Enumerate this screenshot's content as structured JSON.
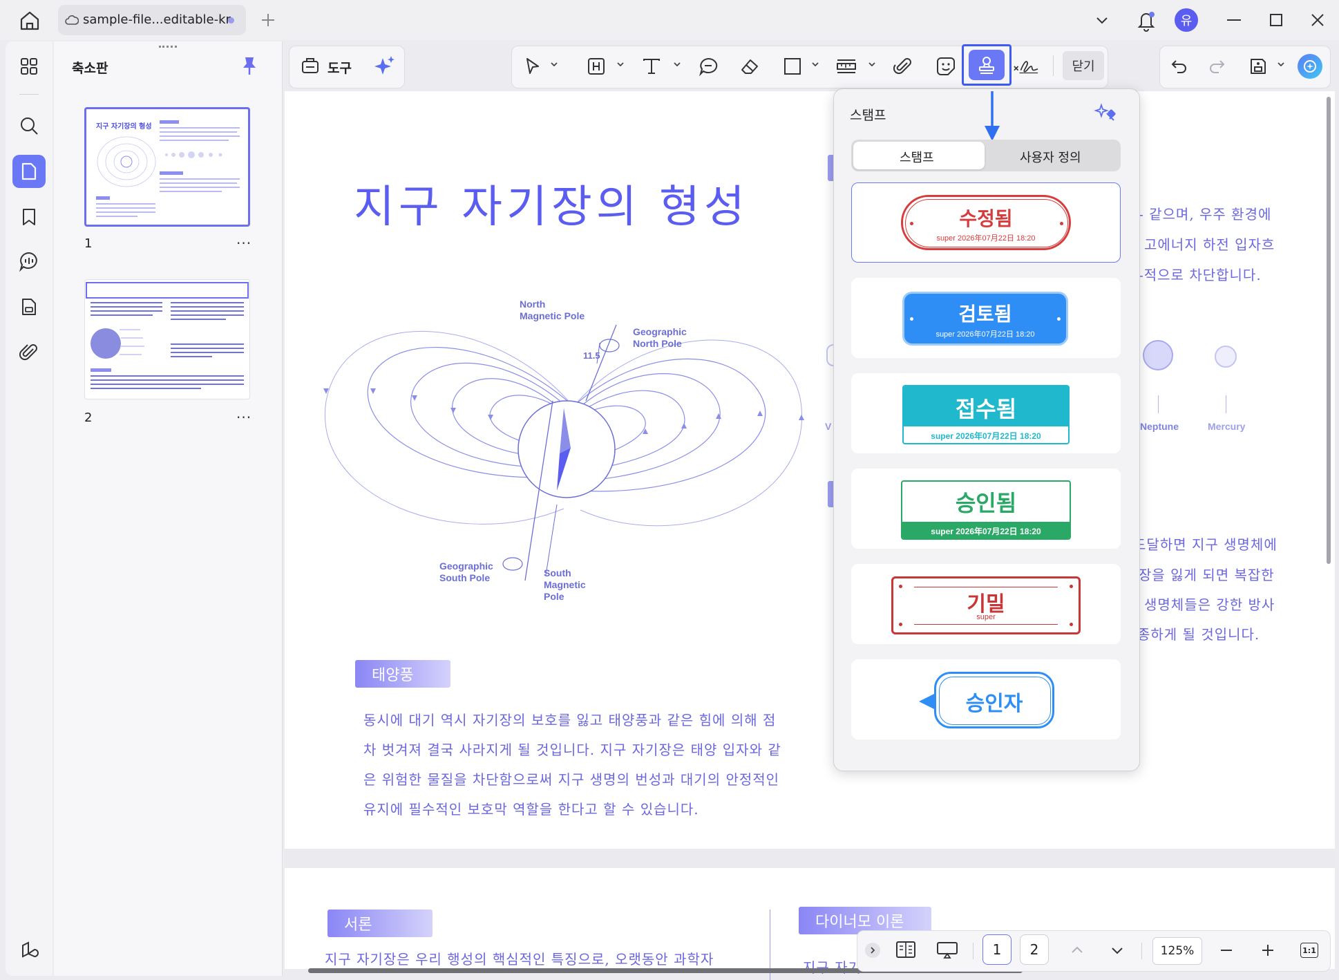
{
  "window": {
    "tab_title": "sample-file...editable-kr",
    "user_initial": "유",
    "accent": "#6b78f5"
  },
  "sidebar": {
    "panel_title": "축소판",
    "pages": [
      {
        "number": "1",
        "more": "···"
      },
      {
        "number": "2",
        "more": "···"
      }
    ],
    "thumb1_title": "지구 자기장의 형성"
  },
  "toolbar": {
    "tools_label": "도구",
    "close_label": "닫기"
  },
  "stamp_panel": {
    "title": "스탬프",
    "tabs": [
      {
        "label": "스탬프",
        "active": true
      },
      {
        "label": "사용자 정의",
        "active": false
      }
    ],
    "stamps": [
      {
        "label": "수정됨",
        "sub": "super 2026年07月22日 18:20",
        "color": "#d63c3c"
      },
      {
        "label": "검토됨",
        "sub": "super 2026年07月22日 18:20",
        "color": "#2f8ef5"
      },
      {
        "label": "접수됨",
        "sub": "super 2026年07月22日 18:20",
        "color": "#1fb8cc"
      },
      {
        "label": "승인됨",
        "sub": "super 2026年07月22日 18:20",
        "color": "#2aa866"
      },
      {
        "label": "기밀",
        "sub": "super",
        "color": "#c83636"
      },
      {
        "label": "승인자",
        "sub": "",
        "color": "#2f8ef5"
      }
    ]
  },
  "document": {
    "title": "지구 자기장의 형성",
    "diagram_labels": {
      "north_magnetic_1": "North",
      "north_magnetic_2": "Magnetic Pole",
      "geo_north_1": "Geographic",
      "geo_north_2": "North Pole",
      "angle": "11.5",
      "geo_south_1": "Geographic",
      "geo_south_2": "South Pole",
      "south_magnetic_1": "South",
      "south_magnetic_2": "Magnetic",
      "south_magnetic_3": "Pole"
    },
    "right_text_1": [
      "- 같으며, 우주 환경에",
      "고에너지 하전 입자흐",
      "-적으로 차단합니다."
    ],
    "planets": [
      "Neptune",
      "Mercury"
    ],
    "planet_partial": "V",
    "right_text_2": [
      "도달하면 지구 생명체에",
      "장을 잃게 되면 복잡한",
      "생명체들은 강한 방사",
      "종하게 될 것입니다."
    ],
    "section_solar_wind": "태양풍",
    "solar_wind_text": [
      "동시에 대기 역시 자기장의 보호를 잃고 태양풍과 같은 힘에 의해 점",
      "차 벗겨져 결국 사라지게 될 것입니다. 지구 자기장은 태양 입자와 같",
      "은 위험한 물질을 차단함으로써 지구 생명의 번성과 대기의 안정적인",
      "유지에 필수적인 보호막 역할을 한다고 할 수 있습니다."
    ],
    "section_intro": "서론",
    "intro_text": "지구 자기장은 우리 행성의 핵심적인 특징으로, 오랫동안 과학자",
    "section_dynamo": "다이너모 이론",
    "dynamo_text": "지구 자기"
  },
  "bottom_bar": {
    "pages": [
      "1",
      "2"
    ],
    "current_page": "1",
    "zoom": "125%",
    "fit_label": "1:1"
  }
}
